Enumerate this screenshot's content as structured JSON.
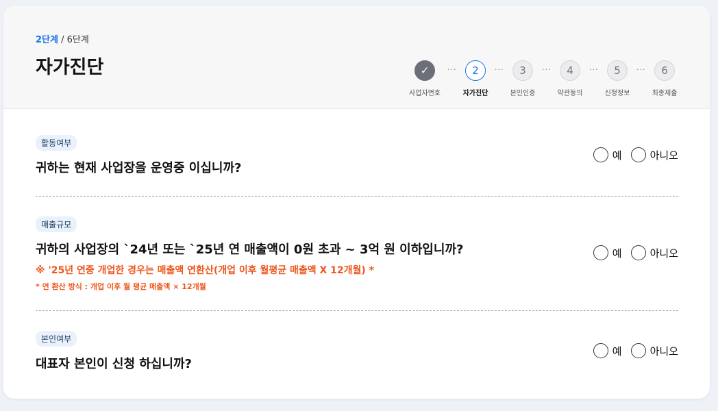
{
  "header": {
    "step_current": "2단계",
    "step_total": " / 6단계",
    "title": "자가진단"
  },
  "stepper": {
    "steps": [
      {
        "num": "",
        "label": "사업자번호",
        "state": "done"
      },
      {
        "num": "2",
        "label": "자가진단",
        "state": "active"
      },
      {
        "num": "3",
        "label": "본인인증",
        "state": "pending"
      },
      {
        "num": "4",
        "label": "약관동의",
        "state": "pending"
      },
      {
        "num": "5",
        "label": "신청정보",
        "state": "pending"
      },
      {
        "num": "6",
        "label": "최종제출",
        "state": "pending"
      }
    ],
    "separator": "···",
    "check_glyph": "✓"
  },
  "questions": [
    {
      "badge": "활동여부",
      "text": "귀하는 현재 사업장을 운영중 이십니까?",
      "yes": "예",
      "no": "아니오"
    },
    {
      "badge": "매출규모",
      "text": "귀하의 사업장의 `24년 또는 `25년 연 매출액이 0원 초과 ~ 3억 원 이하입니까?",
      "note1": "※ '25년 연중 개업한 경우는 매출액 연환산(개업 이후 월평균 매출액 X 12개월) *",
      "note2": "* 연 환산 방식 : 개업 이후 월 평균 매출액 × 12개월",
      "yes": "예",
      "no": "아니오"
    },
    {
      "badge": "본인여부",
      "text": "대표자 본인이 신청 하십니까?",
      "yes": "예",
      "no": "아니오"
    }
  ],
  "colors": {
    "accent": "#1a73e8",
    "warning": "#f0561c",
    "done": "#6b7078"
  }
}
